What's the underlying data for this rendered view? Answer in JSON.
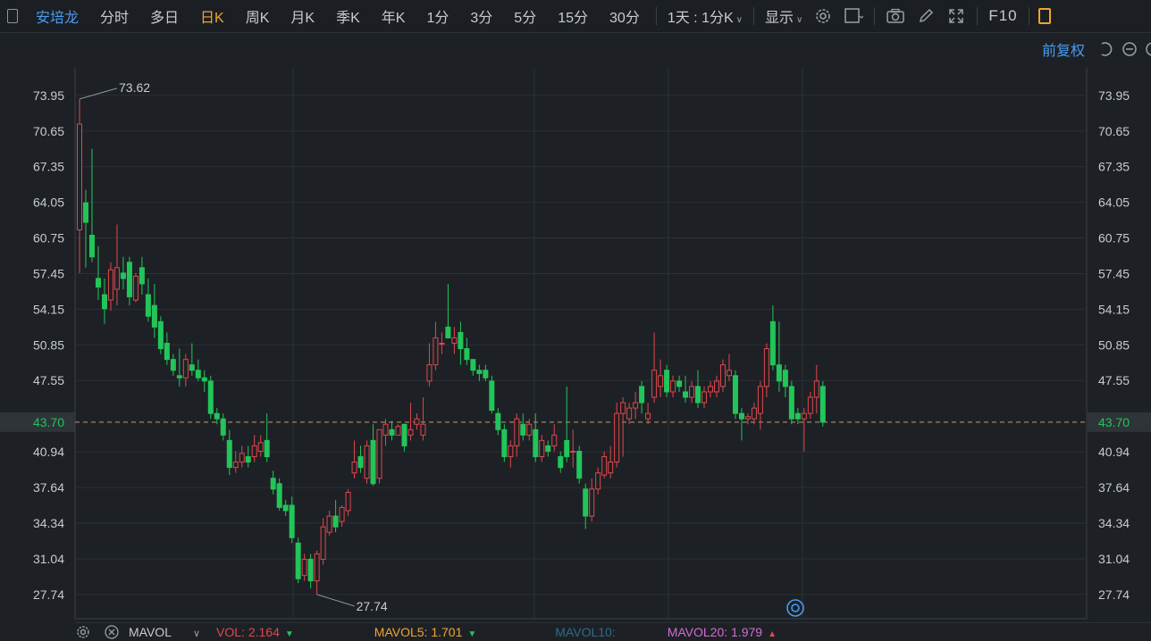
{
  "toolbar": {
    "stock_name": "安培龙",
    "tabs": [
      {
        "label": "分时",
        "active": false
      },
      {
        "label": "多日",
        "active": false
      },
      {
        "label": "日K",
        "active": true
      },
      {
        "label": "周K",
        "active": false
      },
      {
        "label": "月K",
        "active": false
      },
      {
        "label": "季K",
        "active": false
      },
      {
        "label": "年K",
        "active": false
      },
      {
        "label": "1分",
        "active": false
      },
      {
        "label": "3分",
        "active": false
      },
      {
        "label": "5分",
        "active": false
      },
      {
        "label": "15分",
        "active": false
      },
      {
        "label": "30分",
        "active": false
      }
    ],
    "period_select": "1天 : 1分K",
    "display_select": "显示",
    "f10_label": "F10"
  },
  "adjust_label": "前复权",
  "colors": {
    "up": "#e0474c",
    "down": "#22c55a",
    "bg": "#1d2125",
    "grid": "#2c3136",
    "accent": "#4a9bf0",
    "active_tab": "#f2a431"
  },
  "bottom": {
    "mavol_label": "MAVOL",
    "vol_text": "VOL: 2.164",
    "mavol5_text": "MAVOL5: 1.701",
    "mavol10_text": "MAVOL10:",
    "mavol20_text": "MAVOL20: 1.979"
  },
  "chart_data": {
    "type": "candlestick",
    "ylim": [
      25.5,
      76.5
    ],
    "y_ticks": [
      "73.95",
      "70.65",
      "67.35",
      "64.05",
      "60.75",
      "57.45",
      "54.15",
      "50.85",
      "47.55",
      "43.70",
      "40.94",
      "37.64",
      "34.34",
      "31.04",
      "27.74"
    ],
    "current_price": 43.7,
    "max_label": "73.62",
    "min_label": "27.74",
    "candles": [
      {
        "o": 61.5,
        "h": 73.62,
        "l": 57.5,
        "c": 71.3
      },
      {
        "o": 64.0,
        "h": 65.2,
        "l": 58.0,
        "c": 62.2
      },
      {
        "o": 61.0,
        "h": 69.0,
        "l": 58.5,
        "c": 59.0
      },
      {
        "o": 57.0,
        "h": 60.0,
        "l": 55.0,
        "c": 56.2
      },
      {
        "o": 55.5,
        "h": 57.0,
        "l": 52.8,
        "c": 54.2
      },
      {
        "o": 55.0,
        "h": 58.5,
        "l": 54.0,
        "c": 57.8
      },
      {
        "o": 56.0,
        "h": 62.0,
        "l": 54.5,
        "c": 58.0
      },
      {
        "o": 57.5,
        "h": 59.0,
        "l": 56.0,
        "c": 57.0
      },
      {
        "o": 58.5,
        "h": 59.0,
        "l": 54.5,
        "c": 55.3
      },
      {
        "o": 55.0,
        "h": 57.5,
        "l": 54.8,
        "c": 57.2
      },
      {
        "o": 58.0,
        "h": 59.0,
        "l": 55.5,
        "c": 56.5
      },
      {
        "o": 55.5,
        "h": 57.0,
        "l": 53.0,
        "c": 53.5
      },
      {
        "o": 54.5,
        "h": 56.5,
        "l": 51.5,
        "c": 52.5
      },
      {
        "o": 53.0,
        "h": 53.5,
        "l": 50.0,
        "c": 50.5
      },
      {
        "o": 51.0,
        "h": 52.0,
        "l": 49.0,
        "c": 49.5
      },
      {
        "o": 49.5,
        "h": 50.0,
        "l": 48.0,
        "c": 48.5
      },
      {
        "o": 48.0,
        "h": 50.5,
        "l": 47.0,
        "c": 47.8
      },
      {
        "o": 47.8,
        "h": 50.0,
        "l": 47.0,
        "c": 49.5
      },
      {
        "o": 49.0,
        "h": 51.0,
        "l": 48.0,
        "c": 48.5
      },
      {
        "o": 48.5,
        "h": 49.5,
        "l": 47.5,
        "c": 47.8
      },
      {
        "o": 47.8,
        "h": 48.5,
        "l": 46.5,
        "c": 47.5
      },
      {
        "o": 47.5,
        "h": 48.0,
        "l": 44.0,
        "c": 44.5
      },
      {
        "o": 44.5,
        "h": 45.0,
        "l": 43.5,
        "c": 44.0
      },
      {
        "o": 44.0,
        "h": 44.5,
        "l": 42.0,
        "c": 42.5
      },
      {
        "o": 42.0,
        "h": 43.0,
        "l": 38.8,
        "c": 39.5
      },
      {
        "o": 39.5,
        "h": 41.0,
        "l": 39.0,
        "c": 40.0
      },
      {
        "o": 40.0,
        "h": 41.5,
        "l": 39.5,
        "c": 40.8
      },
      {
        "o": 40.5,
        "h": 41.5,
        "l": 39.5,
        "c": 40.0
      },
      {
        "o": 40.5,
        "h": 42.5,
        "l": 40.0,
        "c": 41.5
      },
      {
        "o": 41.0,
        "h": 42.5,
        "l": 40.5,
        "c": 41.8
      },
      {
        "o": 42.0,
        "h": 44.5,
        "l": 40.0,
        "c": 40.5
      },
      {
        "o": 38.5,
        "h": 39.2,
        "l": 37.0,
        "c": 37.5
      },
      {
        "o": 38.0,
        "h": 38.5,
        "l": 35.5,
        "c": 35.8
      },
      {
        "o": 36.0,
        "h": 36.5,
        "l": 35.0,
        "c": 35.5
      },
      {
        "o": 36.0,
        "h": 36.8,
        "l": 32.5,
        "c": 33.0
      },
      {
        "o": 32.5,
        "h": 33.0,
        "l": 28.8,
        "c": 29.2
      },
      {
        "o": 29.5,
        "h": 31.5,
        "l": 29.0,
        "c": 31.0
      },
      {
        "o": 31.0,
        "h": 31.5,
        "l": 28.3,
        "c": 29.0
      },
      {
        "o": 29.0,
        "h": 31.8,
        "l": 27.74,
        "c": 31.5
      },
      {
        "o": 31.0,
        "h": 34.8,
        "l": 30.5,
        "c": 34.0
      },
      {
        "o": 33.5,
        "h": 35.5,
        "l": 33.2,
        "c": 35.0
      },
      {
        "o": 35.0,
        "h": 36.5,
        "l": 33.5,
        "c": 34.0
      },
      {
        "o": 34.5,
        "h": 36.0,
        "l": 34.0,
        "c": 35.8
      },
      {
        "o": 35.5,
        "h": 37.5,
        "l": 35.0,
        "c": 37.2
      },
      {
        "o": 39.0,
        "h": 42.0,
        "l": 38.5,
        "c": 40.0
      },
      {
        "o": 40.5,
        "h": 41.5,
        "l": 39.0,
        "c": 39.5
      },
      {
        "o": 38.5,
        "h": 42.0,
        "l": 38.0,
        "c": 41.5
      },
      {
        "o": 42.0,
        "h": 43.5,
        "l": 37.8,
        "c": 38.0
      },
      {
        "o": 38.5,
        "h": 43.0,
        "l": 38.0,
        "c": 43.0
      },
      {
        "o": 42.5,
        "h": 44.0,
        "l": 41.5,
        "c": 43.5
      },
      {
        "o": 43.0,
        "h": 43.8,
        "l": 42.0,
        "c": 42.5
      },
      {
        "o": 42.5,
        "h": 43.5,
        "l": 42.5,
        "c": 43.3
      },
      {
        "o": 43.5,
        "h": 43.5,
        "l": 41.0,
        "c": 41.5
      },
      {
        "o": 42.5,
        "h": 45.5,
        "l": 42.0,
        "c": 43.0
      },
      {
        "o": 43.5,
        "h": 44.5,
        "l": 43.0,
        "c": 44.0
      },
      {
        "o": 42.5,
        "h": 46.0,
        "l": 42.0,
        "c": 43.5
      },
      {
        "o": 47.5,
        "h": 51.0,
        "l": 47.0,
        "c": 49.0
      },
      {
        "o": 49.0,
        "h": 53.0,
        "l": 48.5,
        "c": 51.5
      },
      {
        "o": 51.0,
        "h": 52.0,
        "l": 50.0,
        "c": 51.0
      },
      {
        "o": 52.5,
        "h": 56.5,
        "l": 51.5,
        "c": 51.5
      },
      {
        "o": 51.0,
        "h": 52.5,
        "l": 50.0,
        "c": 51.5
      },
      {
        "o": 52.0,
        "h": 53.0,
        "l": 49.0,
        "c": 50.5
      },
      {
        "o": 50.5,
        "h": 51.5,
        "l": 49.0,
        "c": 49.5
      },
      {
        "o": 49.5,
        "h": 49.5,
        "l": 48.0,
        "c": 48.5
      },
      {
        "o": 48.5,
        "h": 49.0,
        "l": 47.5,
        "c": 48.2
      },
      {
        "o": 48.5,
        "h": 49.0,
        "l": 47.5,
        "c": 47.8
      },
      {
        "o": 47.5,
        "h": 48.0,
        "l": 44.5,
        "c": 44.8
      },
      {
        "o": 44.5,
        "h": 45.0,
        "l": 42.5,
        "c": 43.0
      },
      {
        "o": 43.0,
        "h": 43.5,
        "l": 40.0,
        "c": 40.5
      },
      {
        "o": 40.5,
        "h": 42.0,
        "l": 39.5,
        "c": 41.5
      },
      {
        "o": 41.5,
        "h": 44.5,
        "l": 40.5,
        "c": 44.0
      },
      {
        "o": 43.5,
        "h": 44.5,
        "l": 42.0,
        "c": 42.5
      },
      {
        "o": 42.5,
        "h": 44.0,
        "l": 42.0,
        "c": 43.5
      },
      {
        "o": 43.0,
        "h": 44.5,
        "l": 40.0,
        "c": 40.5
      },
      {
        "o": 40.5,
        "h": 42.5,
        "l": 40.0,
        "c": 42.0
      },
      {
        "o": 41.5,
        "h": 42.0,
        "l": 40.5,
        "c": 41.0
      },
      {
        "o": 41.5,
        "h": 43.5,
        "l": 41.0,
        "c": 42.5
      },
      {
        "o": 40.5,
        "h": 41.0,
        "l": 39.0,
        "c": 39.5
      },
      {
        "o": 42.0,
        "h": 47.0,
        "l": 40.0,
        "c": 40.5
      },
      {
        "o": 41.0,
        "h": 43.0,
        "l": 39.5,
        "c": 41.0
      },
      {
        "o": 41.0,
        "h": 41.5,
        "l": 38.0,
        "c": 38.5
      },
      {
        "o": 37.5,
        "h": 38.0,
        "l": 33.8,
        "c": 35.0
      },
      {
        "o": 35.0,
        "h": 38.5,
        "l": 34.5,
        "c": 37.5
      },
      {
        "o": 37.5,
        "h": 39.5,
        "l": 37.0,
        "c": 39.0
      },
      {
        "o": 38.8,
        "h": 41.0,
        "l": 38.5,
        "c": 40.5
      },
      {
        "o": 39.0,
        "h": 41.5,
        "l": 38.5,
        "c": 40.0
      },
      {
        "o": 40.0,
        "h": 45.5,
        "l": 39.5,
        "c": 44.5
      },
      {
        "o": 44.5,
        "h": 46.0,
        "l": 40.5,
        "c": 45.5
      },
      {
        "o": 44.0,
        "h": 45.5,
        "l": 43.5,
        "c": 45.0
      },
      {
        "o": 45.0,
        "h": 46.5,
        "l": 44.0,
        "c": 45.5
      },
      {
        "o": 47.0,
        "h": 47.5,
        "l": 44.5,
        "c": 45.5
      },
      {
        "o": 44.0,
        "h": 45.5,
        "l": 43.5,
        "c": 44.5
      },
      {
        "o": 46.0,
        "h": 52.0,
        "l": 45.5,
        "c": 48.5
      },
      {
        "o": 47.0,
        "h": 49.5,
        "l": 46.0,
        "c": 48.0
      },
      {
        "o": 48.5,
        "h": 49.0,
        "l": 46.0,
        "c": 46.5
      },
      {
        "o": 46.5,
        "h": 48.0,
        "l": 46.0,
        "c": 47.5
      },
      {
        "o": 47.5,
        "h": 48.0,
        "l": 46.5,
        "c": 47.0
      },
      {
        "o": 46.5,
        "h": 48.0,
        "l": 45.5,
        "c": 46.0
      },
      {
        "o": 46.0,
        "h": 47.5,
        "l": 45.5,
        "c": 47.0
      },
      {
        "o": 47.0,
        "h": 48.5,
        "l": 45.0,
        "c": 45.5
      },
      {
        "o": 45.5,
        "h": 47.0,
        "l": 45.0,
        "c": 46.5
      },
      {
        "o": 46.5,
        "h": 47.5,
        "l": 46.0,
        "c": 47.0
      },
      {
        "o": 46.5,
        "h": 48.0,
        "l": 46.0,
        "c": 47.5
      },
      {
        "o": 47.0,
        "h": 49.5,
        "l": 46.5,
        "c": 49.0
      },
      {
        "o": 48.0,
        "h": 50.0,
        "l": 47.5,
        "c": 48.5
      },
      {
        "o": 48.0,
        "h": 48.5,
        "l": 44.0,
        "c": 44.5
      },
      {
        "o": 44.5,
        "h": 45.0,
        "l": 42.0,
        "c": 44.0
      },
      {
        "o": 44.0,
        "h": 44.5,
        "l": 43.5,
        "c": 44.2
      },
      {
        "o": 44.0,
        "h": 45.5,
        "l": 43.5,
        "c": 45.0
      },
      {
        "o": 44.5,
        "h": 47.5,
        "l": 43.0,
        "c": 47.0
      },
      {
        "o": 47.0,
        "h": 51.0,
        "l": 46.0,
        "c": 50.5
      },
      {
        "o": 53.0,
        "h": 54.5,
        "l": 48.5,
        "c": 49.0
      },
      {
        "o": 49.0,
        "h": 53.0,
        "l": 46.5,
        "c": 47.5
      },
      {
        "o": 48.5,
        "h": 49.0,
        "l": 46.0,
        "c": 47.0
      },
      {
        "o": 47.0,
        "h": 47.5,
        "l": 43.5,
        "c": 44.0
      },
      {
        "o": 44.5,
        "h": 45.0,
        "l": 43.5,
        "c": 44.0
      },
      {
        "o": 44.0,
        "h": 45.0,
        "l": 41.0,
        "c": 44.5
      },
      {
        "o": 44.5,
        "h": 46.5,
        "l": 44.0,
        "c": 46.0
      },
      {
        "o": 46.0,
        "h": 49.0,
        "l": 44.5,
        "c": 47.5
      },
      {
        "o": 47.0,
        "h": 47.5,
        "l": 43.3,
        "c": 43.7
      }
    ]
  }
}
